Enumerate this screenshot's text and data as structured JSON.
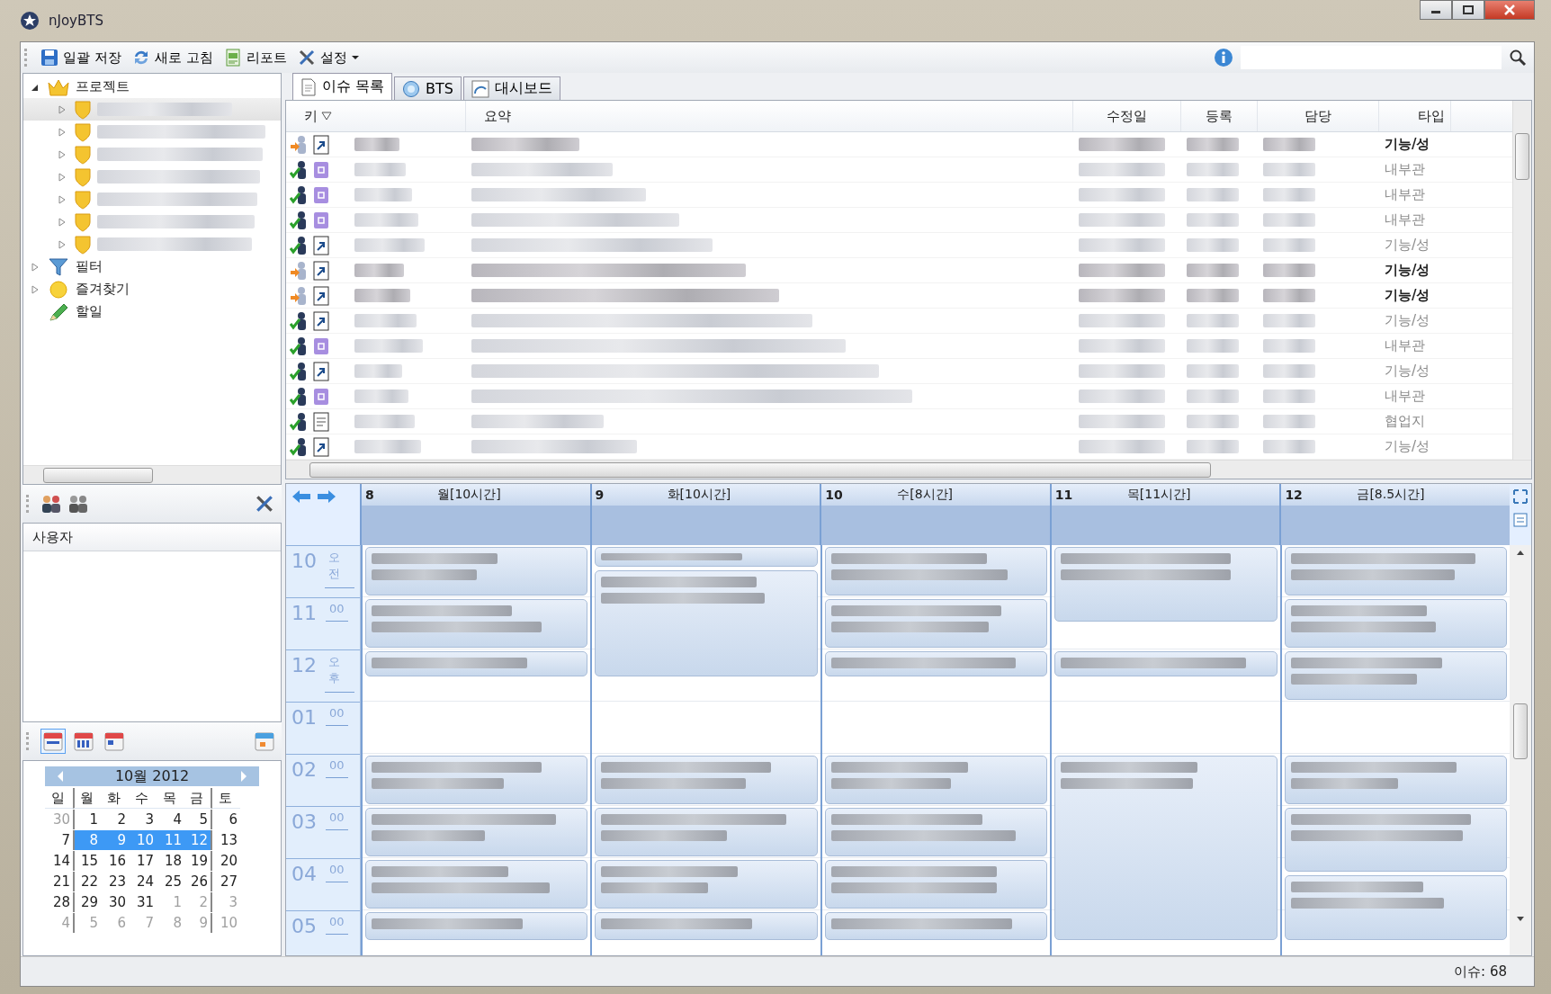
{
  "window": {
    "title": "nJoyBTS"
  },
  "toolbar": {
    "items": [
      {
        "label": "일괄 저장",
        "kind": "save",
        "dropdown": false
      },
      {
        "label": "새로 고침",
        "kind": "refresh",
        "dropdown": false
      },
      {
        "label": "리포트",
        "kind": "report",
        "dropdown": false
      },
      {
        "label": "설정",
        "kind": "settings",
        "dropdown": true
      }
    ]
  },
  "nav_tree": {
    "items": [
      {
        "label": "프로젝트",
        "kind": "project",
        "expanded": true,
        "children": [
          {
            "selected": true
          },
          {
            "selected": false
          },
          {
            "selected": false
          },
          {
            "selected": false
          },
          {
            "selected": false
          },
          {
            "selected": false
          },
          {
            "selected": false
          }
        ]
      },
      {
        "label": "필터",
        "kind": "filter",
        "expanded": false
      },
      {
        "label": "즐겨찾기",
        "kind": "favorites",
        "expanded": false
      },
      {
        "label": "할일",
        "kind": "todo"
      }
    ]
  },
  "user_panel": {
    "header": "사용자"
  },
  "calendar_views": [
    {
      "kind": "day",
      "selected": true
    },
    {
      "kind": "workweek",
      "selected": false
    },
    {
      "kind": "week",
      "selected": false
    }
  ],
  "mini_calendar": {
    "month_label": "10월 2012",
    "weekdays": [
      "일",
      "월",
      "화",
      "수",
      "목",
      "금",
      "토"
    ],
    "weeks": [
      [
        {
          "day": "30",
          "other_month": true,
          "selected": false
        },
        {
          "day": "1",
          "other_month": false,
          "selected": false
        },
        {
          "day": "2",
          "other_month": false,
          "selected": false
        },
        {
          "day": "3",
          "other_month": false,
          "selected": false
        },
        {
          "day": "4",
          "other_month": false,
          "selected": false
        },
        {
          "day": "5",
          "other_month": false,
          "selected": false
        },
        {
          "day": "6",
          "other_month": false,
          "selected": false
        }
      ],
      [
        {
          "day": "7",
          "other_month": false,
          "selected": false
        },
        {
          "day": "8",
          "other_month": false,
          "selected": true
        },
        {
          "day": "9",
          "other_month": false,
          "selected": true
        },
        {
          "day": "10",
          "other_month": false,
          "selected": true
        },
        {
          "day": "11",
          "other_month": false,
          "selected": true
        },
        {
          "day": "12",
          "other_month": false,
          "selected": true
        },
        {
          "day": "13",
          "other_month": false,
          "selected": false
        }
      ],
      [
        {
          "day": "14",
          "other_month": false,
          "selected": false
        },
        {
          "day": "15",
          "other_month": false,
          "selected": false
        },
        {
          "day": "16",
          "other_month": false,
          "selected": false
        },
        {
          "day": "17",
          "other_month": false,
          "selected": false
        },
        {
          "day": "18",
          "other_month": false,
          "selected": false
        },
        {
          "day": "19",
          "other_month": false,
          "selected": false
        },
        {
          "day": "20",
          "other_month": false,
          "selected": false
        }
      ],
      [
        {
          "day": "21",
          "other_month": false,
          "selected": false
        },
        {
          "day": "22",
          "other_month": false,
          "selected": false
        },
        {
          "day": "23",
          "other_month": false,
          "selected": false
        },
        {
          "day": "24",
          "other_month": false,
          "selected": false
        },
        {
          "day": "25",
          "other_month": false,
          "selected": false
        },
        {
          "day": "26",
          "other_month": false,
          "selected": false
        },
        {
          "day": "27",
          "other_month": false,
          "selected": false
        }
      ],
      [
        {
          "day": "28",
          "other_month": false,
          "selected": false
        },
        {
          "day": "29",
          "other_month": false,
          "selected": false
        },
        {
          "day": "30",
          "other_month": false,
          "selected": false
        },
        {
          "day": "31",
          "other_month": false,
          "selected": false
        },
        {
          "day": "1",
          "other_month": true,
          "selected": false
        },
        {
          "day": "2",
          "other_month": true,
          "selected": false
        },
        {
          "day": "3",
          "other_month": true,
          "selected": false
        }
      ],
      [
        {
          "day": "4",
          "other_month": true,
          "selected": false
        },
        {
          "day": "5",
          "other_month": true,
          "selected": false
        },
        {
          "day": "6",
          "other_month": true,
          "selected": false
        },
        {
          "day": "7",
          "other_month": true,
          "selected": false
        },
        {
          "day": "8",
          "other_month": true,
          "selected": false
        },
        {
          "day": "9",
          "other_month": true,
          "selected": false
        },
        {
          "day": "10",
          "other_month": true,
          "selected": false
        }
      ]
    ]
  },
  "tabs": [
    {
      "label": "이슈 목록",
      "kind": "list",
      "selected": true
    },
    {
      "label": "BTS",
      "kind": "globe",
      "selected": false
    },
    {
      "label": "대시보드",
      "kind": "dashboard",
      "selected": false
    }
  ],
  "issue_table": {
    "columns": [
      {
        "label": "키",
        "sorted": true
      },
      {
        "label": "요약",
        "sorted": false
      },
      {
        "label": "수정일",
        "sorted": false
      },
      {
        "label": "등록",
        "sorted": false
      },
      {
        "label": "담당",
        "sorted": false
      },
      {
        "label": "타입",
        "sorted": false
      }
    ],
    "rows": [
      {
        "in_progress": true,
        "kind": "link",
        "type": "기능/성",
        "unread": true
      },
      {
        "in_progress": false,
        "kind": "square",
        "type": "내부관",
        "unread": false
      },
      {
        "in_progress": false,
        "kind": "square",
        "type": "내부관",
        "unread": false
      },
      {
        "in_progress": false,
        "kind": "square",
        "type": "내부관",
        "unread": false
      },
      {
        "in_progress": false,
        "kind": "link",
        "type": "기능/성",
        "unread": false
      },
      {
        "in_progress": true,
        "kind": "link",
        "type": "기능/성",
        "unread": true
      },
      {
        "in_progress": true,
        "kind": "link",
        "type": "기능/성",
        "unread": true
      },
      {
        "in_progress": false,
        "kind": "link",
        "type": "기능/성",
        "unread": false
      },
      {
        "in_progress": false,
        "kind": "square",
        "type": "내부관",
        "unread": false
      },
      {
        "in_progress": false,
        "kind": "link",
        "type": "기능/성",
        "unread": false
      },
      {
        "in_progress": false,
        "kind": "square",
        "type": "내부관",
        "unread": false
      },
      {
        "in_progress": false,
        "kind": "doc",
        "type": "협업지",
        "unread": false
      },
      {
        "in_progress": false,
        "kind": "link",
        "type": "기능/성",
        "unread": false
      }
    ]
  },
  "schedule": {
    "days": [
      {
        "date": "8",
        "label": "월[10시간]"
      },
      {
        "date": "9",
        "label": "화[10시간]"
      },
      {
        "date": "10",
        "label": "수[8시간]"
      },
      {
        "date": "11",
        "label": "목[11시간]"
      },
      {
        "date": "12",
        "label": "금[8.5시간]"
      }
    ],
    "hours": [
      {
        "hour": "10",
        "suffix": "오전"
      },
      {
        "hour": "11",
        "suffix": "00"
      },
      {
        "hour": "12",
        "suffix": "오후"
      },
      {
        "hour": "01",
        "suffix": "00"
      },
      {
        "hour": "02",
        "suffix": "00"
      },
      {
        "hour": "03",
        "suffix": "00"
      },
      {
        "hour": "04",
        "suffix": "00"
      },
      {
        "hour": "05",
        "suffix": "00"
      }
    ]
  },
  "status_bar": {
    "text": "이슈: 68"
  }
}
